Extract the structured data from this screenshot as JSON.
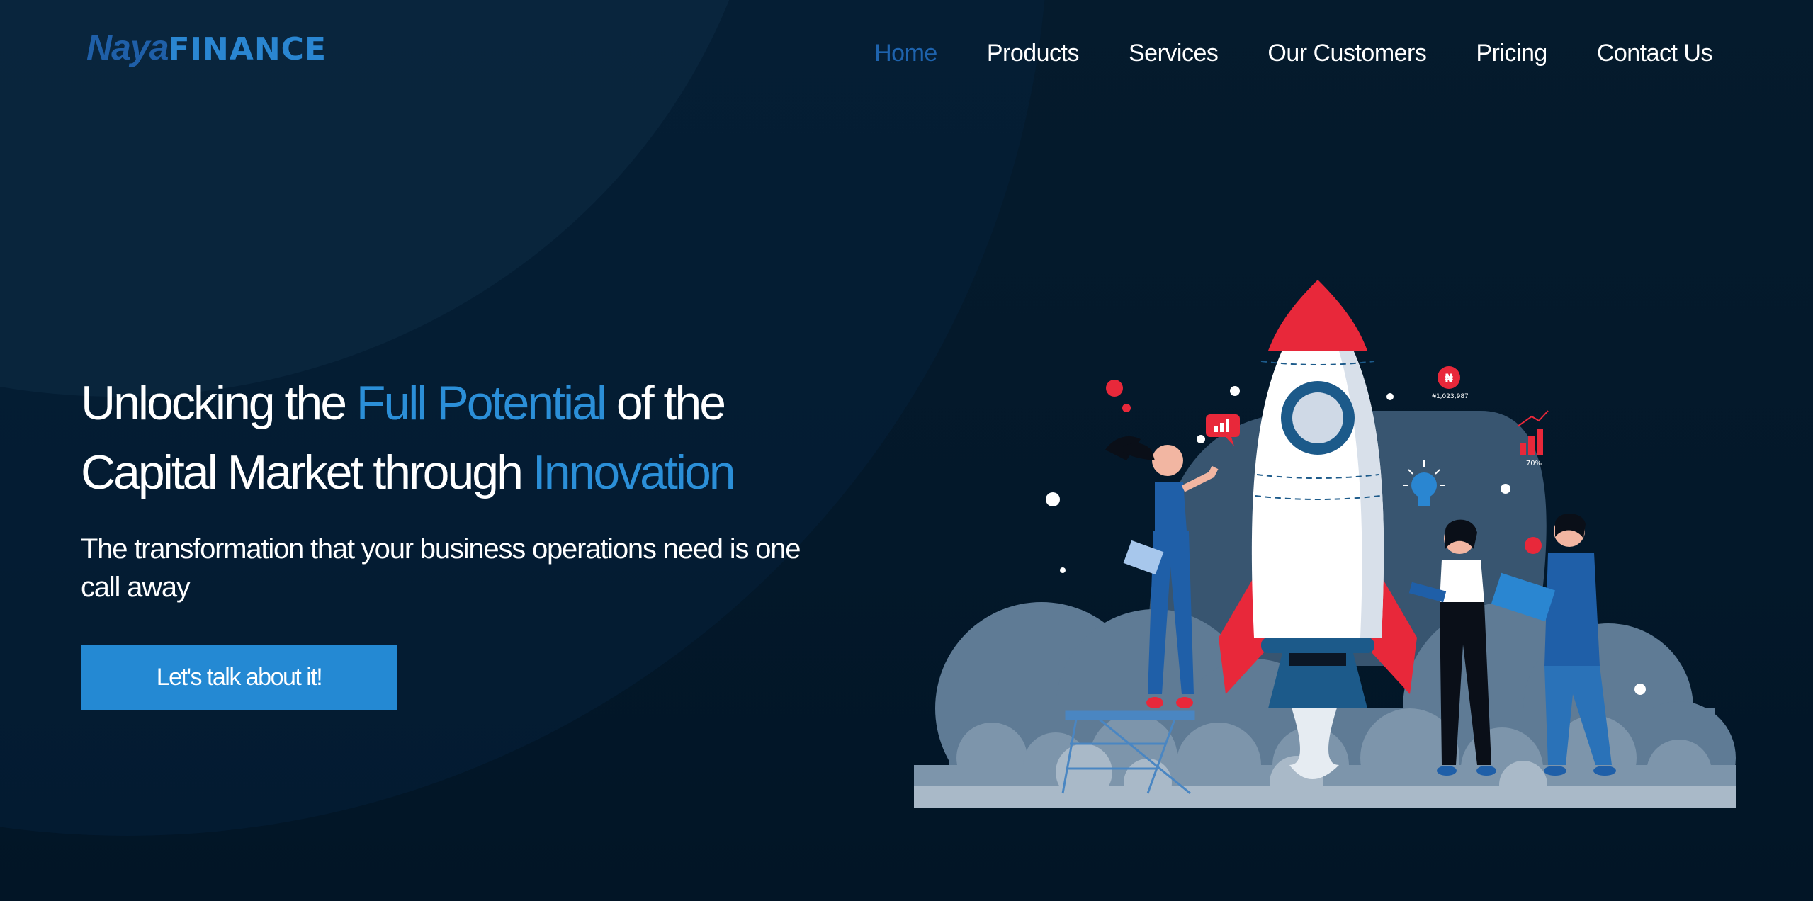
{
  "brand": {
    "logo_part1": "Naya",
    "logo_part2": "FINANCE"
  },
  "nav": {
    "items": [
      {
        "label": "Home"
      },
      {
        "label": "Products"
      },
      {
        "label": "Services"
      },
      {
        "label": "Our Customers"
      },
      {
        "label": "Pricing"
      },
      {
        "label": "Contact Us"
      }
    ],
    "active_color": "#1e63ad"
  },
  "hero": {
    "headline_line1_a": "Unlocking the ",
    "headline_line1_hl": "Full Potential",
    "headline_line1_b": " of the",
    "headline_line2_a": "Capital Market through ",
    "headline_line2_hl": "Innovation",
    "subtext": "The transformation that your business operations need is one call away",
    "cta_label": "Let's talk about it!"
  },
  "illustration": {
    "amount_label": "₦1,023,987",
    "currency_symbol": "₦",
    "percent_label": "70%"
  },
  "colors": {
    "background": "#03192b",
    "accent": "#2b8fd8",
    "button": "#2489d3",
    "rocket_red": "#e8283a"
  }
}
